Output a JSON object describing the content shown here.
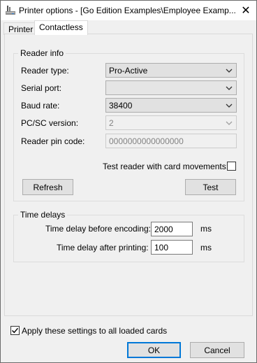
{
  "window": {
    "title": "Printer options - [Go Edition Examples\\Employee Examp...",
    "close_glyph": "✕"
  },
  "tabs": [
    {
      "label": "Printer",
      "active": false
    },
    {
      "label": "Contactless",
      "active": true
    }
  ],
  "reader_info": {
    "group_title": "Reader info",
    "reader_type": {
      "label": "Reader type:",
      "value": "Pro-Active"
    },
    "serial_port": {
      "label": "Serial port:",
      "value": ""
    },
    "baud_rate": {
      "label": "Baud rate:",
      "value": "38400"
    },
    "pcsc_version": {
      "label": "PC/SC version:",
      "value": "2"
    },
    "reader_pin": {
      "label": "Reader pin code:",
      "value": "0000000000000000"
    },
    "test_movements": {
      "label": "Test reader with card movements:",
      "checked": false
    },
    "refresh_label": "Refresh",
    "test_label": "Test"
  },
  "time_delays": {
    "group_title": "Time delays",
    "before_encoding": {
      "label": "Time delay before encoding:",
      "value": "2000",
      "unit": "ms"
    },
    "after_printing": {
      "label": "Time delay after printing:",
      "value": "100",
      "unit": "ms"
    }
  },
  "apply_all": {
    "label": "Apply these settings to all loaded cards",
    "checked": true
  },
  "footer": {
    "ok_label": "OK",
    "cancel_label": "Cancel"
  },
  "icons": {
    "app": "printer-icon",
    "close": "close-icon",
    "dropdown": "chevron-down-icon",
    "check": "checkmark-icon"
  }
}
